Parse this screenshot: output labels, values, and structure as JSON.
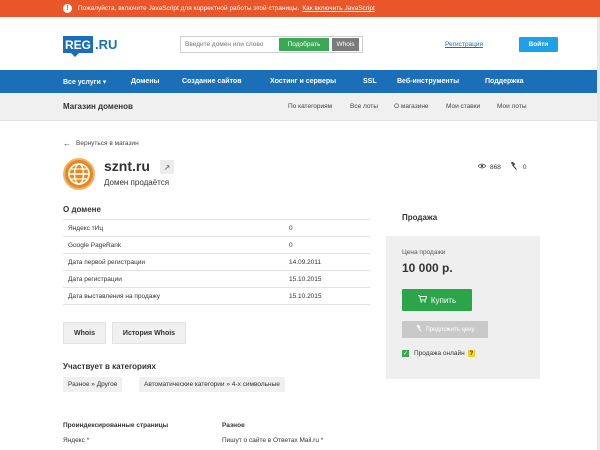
{
  "warning": {
    "icon": "!",
    "text": "Пожалуйста, включите JavaScript для корректной работы этой страницы.",
    "link": "Как включить JavaScript"
  },
  "header": {
    "logo_box": "REG",
    "logo_text": ".RU",
    "search_placeholder": "Введите домен или слово",
    "pick_button": "Подобрать",
    "whois_button": "Whois",
    "register_link": "Регистрация",
    "login_button": "Войти"
  },
  "nav": {
    "items": [
      "Все услуги ▾",
      "Домены",
      "Создание сайтов",
      "Хостинг и серверы",
      "SSL",
      "Веб-инструменты",
      "Поддержка"
    ]
  },
  "subbar": {
    "title": "Магазин доменов",
    "links": [
      "По категориям",
      "Все лоты",
      "О магазине",
      "Мои ставки",
      "Мои лоты"
    ]
  },
  "lot": {
    "back_link": "Вернуться в магазин",
    "domain": "sznt.ru",
    "status": "Домен продаётся",
    "views": "868",
    "bids": "0"
  },
  "about": {
    "heading": "О домене",
    "rows": [
      {
        "label": "Яндекс тИц",
        "value": "0"
      },
      {
        "label": "Google PageRank",
        "value": "0"
      },
      {
        "label": "Дата первой регистрации",
        "value": "14.09.2011"
      },
      {
        "label": "Дата регистрации",
        "value": "15.10.2015"
      },
      {
        "label": "Дата выставления на продажу",
        "value": "15.10.2015"
      }
    ],
    "whois_button": "Whois",
    "history_button": "История Whois"
  },
  "categories": {
    "heading": "Участвует в категориях",
    "tags": [
      "Разное » Другое",
      "Автоматические категории » 4-х символьные"
    ]
  },
  "indexed": {
    "heading": "Проиндексированные страницы",
    "yandex": "Яндекс *"
  },
  "misc": {
    "heading": "Разное",
    "value": "Пишут о сайте в Ответах Mail.ru *"
  },
  "sale": {
    "heading": "Продажа",
    "price_label": "Цена продажи",
    "price": "10 000 р.",
    "buy_button": "Купить",
    "offer_button": "Предложить цену",
    "online_label": "Продажа онлайн",
    "help": "?"
  },
  "colors": {
    "warning": "#e9562a",
    "brand": "#1a6fb8",
    "login": "#1ea1e8",
    "buy": "#2aa54a"
  }
}
